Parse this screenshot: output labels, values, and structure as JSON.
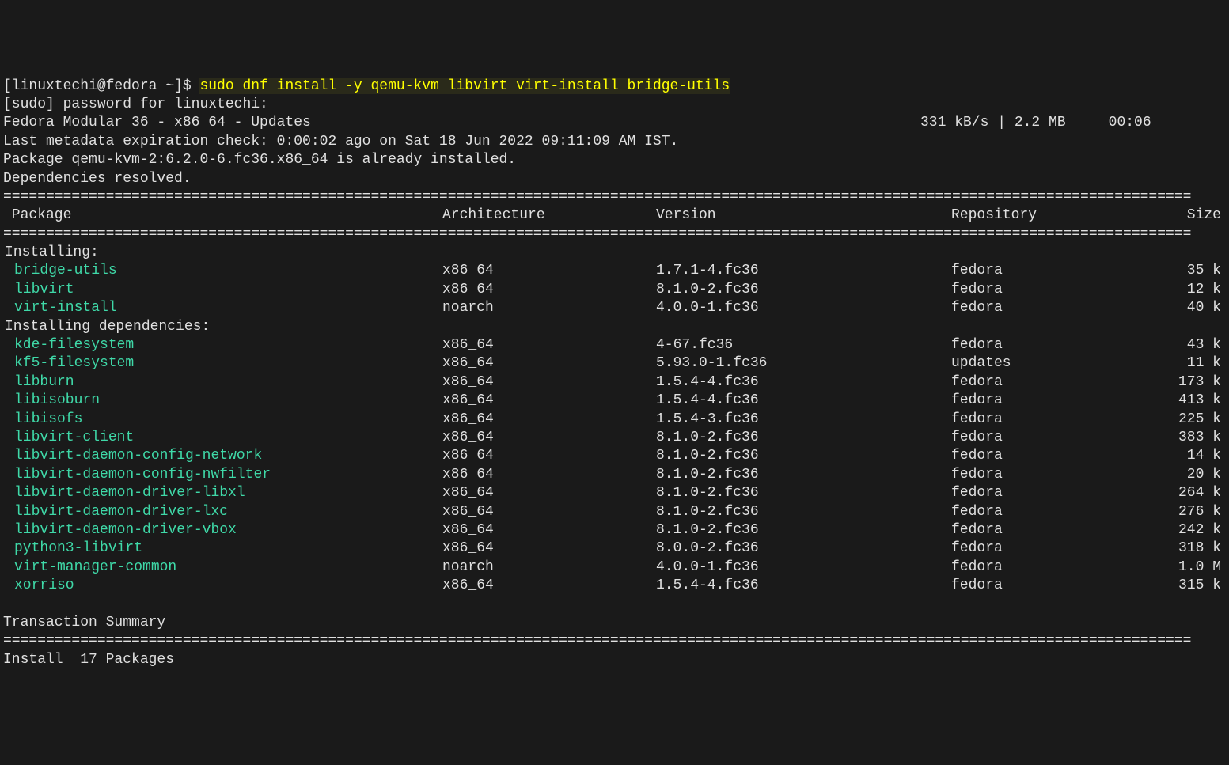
{
  "prompt": {
    "user_host": "[linuxtechi@fedora ~]$ ",
    "command": "sudo dnf install -y qemu-kvm libvirt virt-install bridge-utils"
  },
  "sudo_line": "[sudo] password for linuxtechi:",
  "repo_line": "Fedora Modular 36 - x86_64 - Updates",
  "repo_stats": "331 kB/s | 2.2 MB     00:06",
  "metadata_line": "Last metadata expiration check: 0:00:02 ago on Sat 18 Jun 2022 09:11:09 AM IST.",
  "already_installed": "Package qemu-kvm-2:6.2.0-6.fc36.x86_64 is already installed.",
  "deps_resolved": "Dependencies resolved.",
  "headers": {
    "package": " Package",
    "arch": "Architecture",
    "version": "Version",
    "repo": "Repository",
    "size": "Size"
  },
  "sections": {
    "installing": "Installing:",
    "installing_deps": "Installing dependencies:"
  },
  "installing": [
    {
      "name": "bridge-utils",
      "arch": "x86_64",
      "version": "1.7.1-4.fc36",
      "repo": "fedora",
      "size": "35 k"
    },
    {
      "name": "libvirt",
      "arch": "x86_64",
      "version": "8.1.0-2.fc36",
      "repo": "fedora",
      "size": "12 k"
    },
    {
      "name": "virt-install",
      "arch": "noarch",
      "version": "4.0.0-1.fc36",
      "repo": "fedora",
      "size": "40 k"
    }
  ],
  "dependencies": [
    {
      "name": "kde-filesystem",
      "arch": "x86_64",
      "version": "4-67.fc36",
      "repo": "fedora",
      "size": "43 k"
    },
    {
      "name": "kf5-filesystem",
      "arch": "x86_64",
      "version": "5.93.0-1.fc36",
      "repo": "updates",
      "size": "11 k"
    },
    {
      "name": "libburn",
      "arch": "x86_64",
      "version": "1.5.4-4.fc36",
      "repo": "fedora",
      "size": "173 k"
    },
    {
      "name": "libisoburn",
      "arch": "x86_64",
      "version": "1.5.4-4.fc36",
      "repo": "fedora",
      "size": "413 k"
    },
    {
      "name": "libisofs",
      "arch": "x86_64",
      "version": "1.5.4-3.fc36",
      "repo": "fedora",
      "size": "225 k"
    },
    {
      "name": "libvirt-client",
      "arch": "x86_64",
      "version": "8.1.0-2.fc36",
      "repo": "fedora",
      "size": "383 k"
    },
    {
      "name": "libvirt-daemon-config-network",
      "arch": "x86_64",
      "version": "8.1.0-2.fc36",
      "repo": "fedora",
      "size": "14 k"
    },
    {
      "name": "libvirt-daemon-config-nwfilter",
      "arch": "x86_64",
      "version": "8.1.0-2.fc36",
      "repo": "fedora",
      "size": "20 k"
    },
    {
      "name": "libvirt-daemon-driver-libxl",
      "arch": "x86_64",
      "version": "8.1.0-2.fc36",
      "repo": "fedora",
      "size": "264 k"
    },
    {
      "name": "libvirt-daemon-driver-lxc",
      "arch": "x86_64",
      "version": "8.1.0-2.fc36",
      "repo": "fedora",
      "size": "276 k"
    },
    {
      "name": "libvirt-daemon-driver-vbox",
      "arch": "x86_64",
      "version": "8.1.0-2.fc36",
      "repo": "fedora",
      "size": "242 k"
    },
    {
      "name": "python3-libvirt",
      "arch": "x86_64",
      "version": "8.0.0-2.fc36",
      "repo": "fedora",
      "size": "318 k"
    },
    {
      "name": "virt-manager-common",
      "arch": "noarch",
      "version": "4.0.0-1.fc36",
      "repo": "fedora",
      "size": "1.0 M"
    },
    {
      "name": "xorriso",
      "arch": "x86_64",
      "version": "1.5.4-4.fc36",
      "repo": "fedora",
      "size": "315 k"
    }
  ],
  "summary_title": "Transaction Summary",
  "install_count": "Install  17 Packages",
  "divider": "==========================================================================================================================================="
}
